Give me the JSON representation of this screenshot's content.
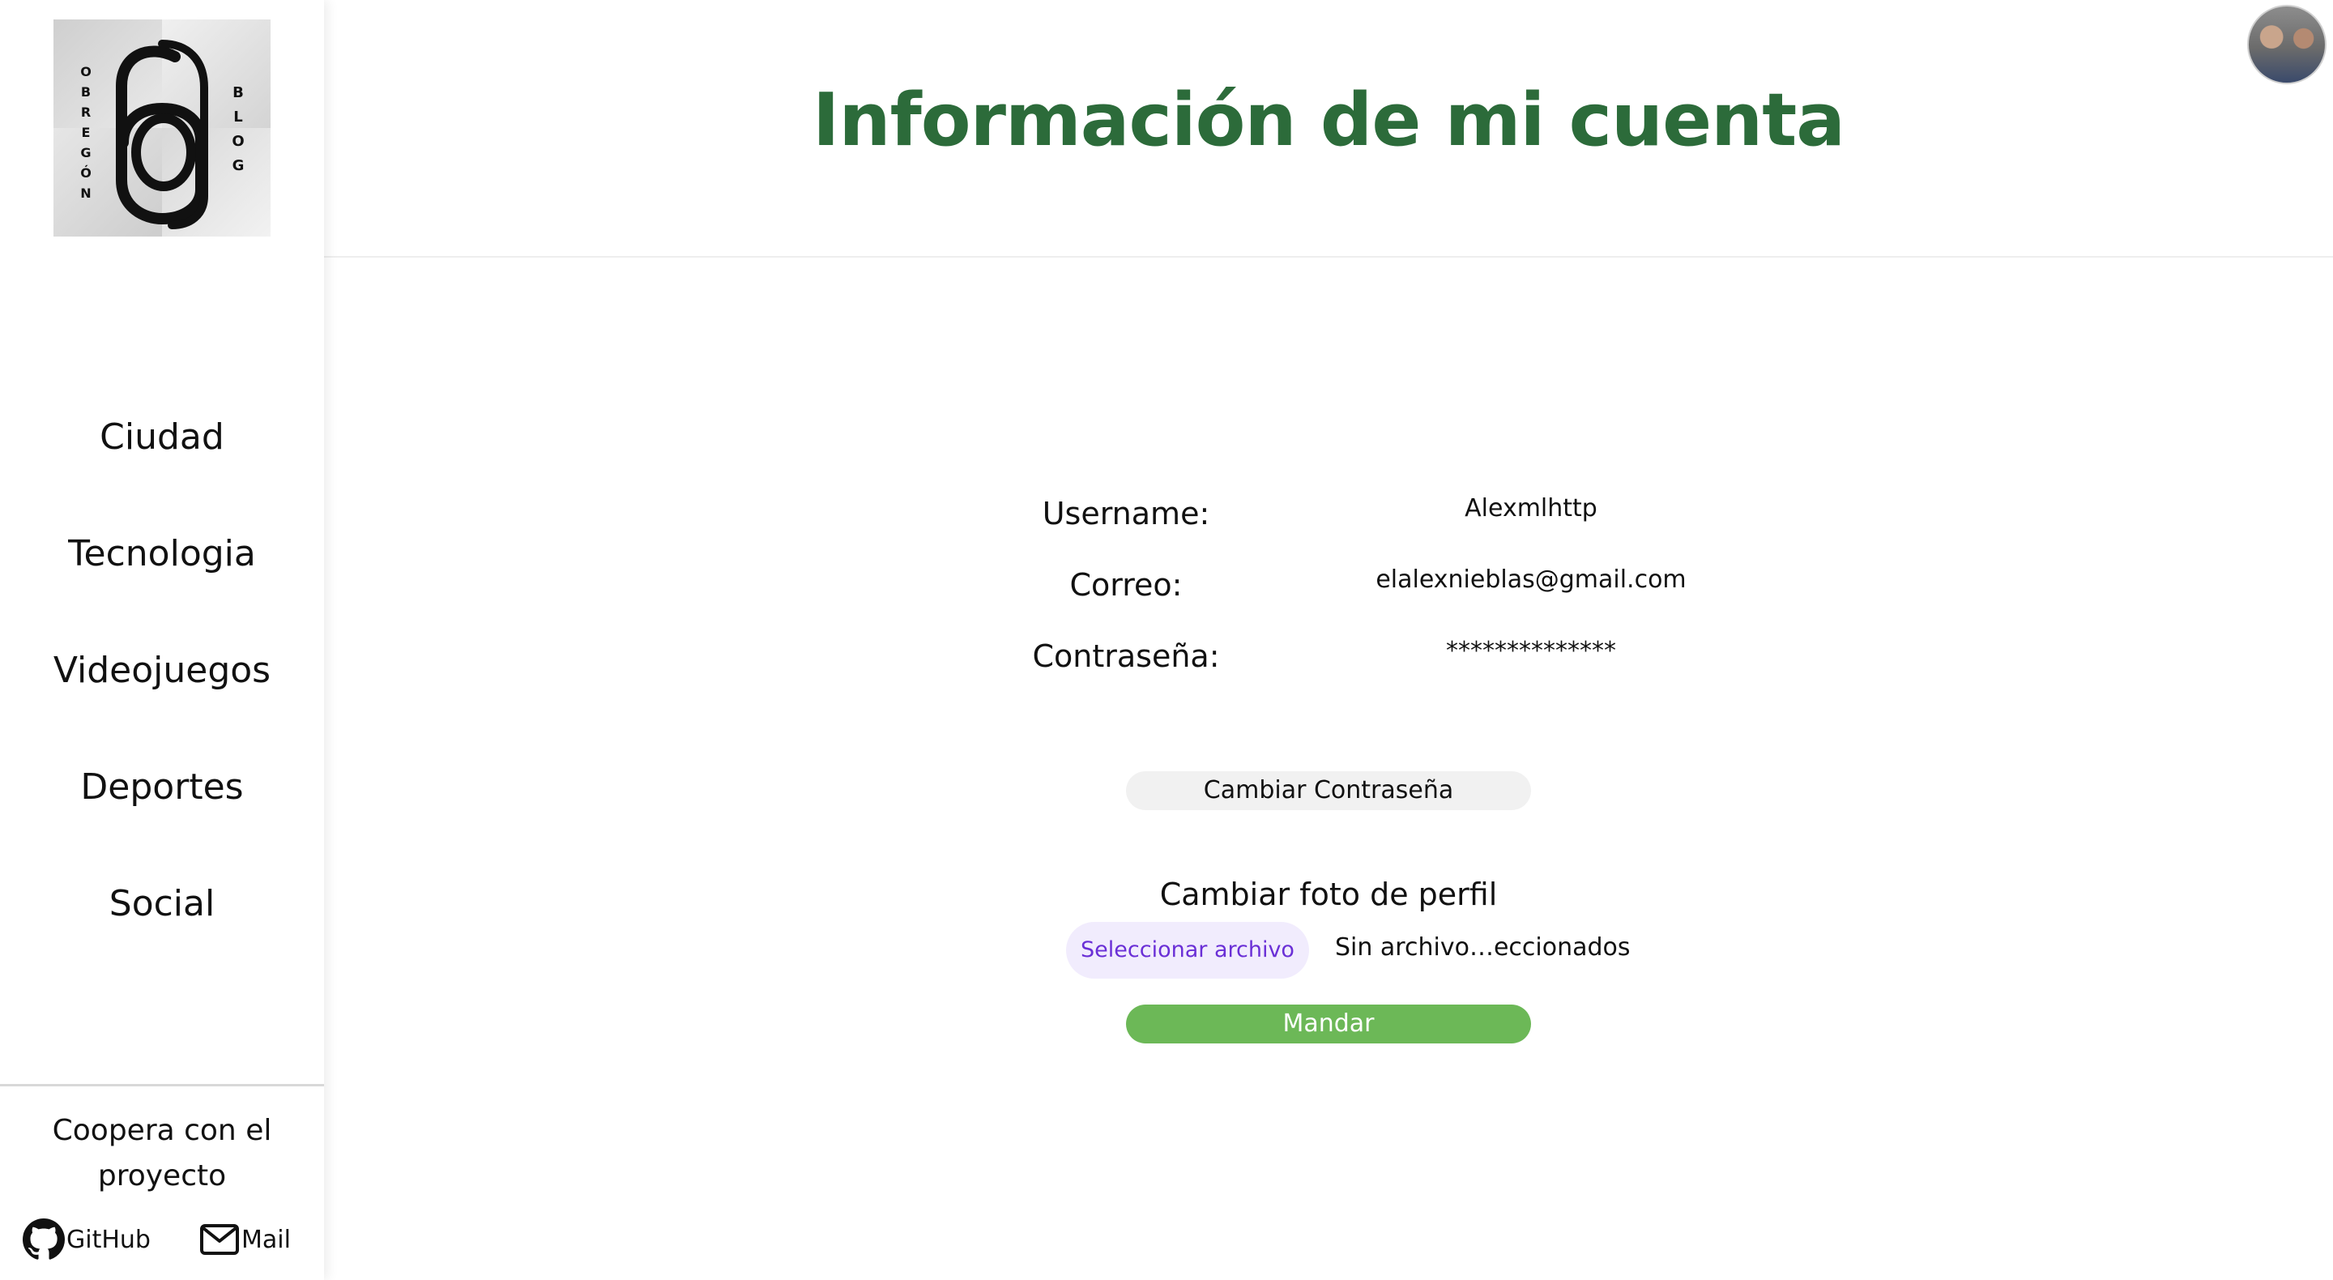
{
  "logo": {
    "left_text": "OBREGÓN",
    "right_text": "BLOG",
    "mark": "6g"
  },
  "sidebar": {
    "items": [
      {
        "label": "Ciudad"
      },
      {
        "label": "Tecnologia"
      },
      {
        "label": "Videojuegos"
      },
      {
        "label": "Deportes"
      },
      {
        "label": "Social"
      }
    ],
    "cooperate_line1": "Coopera con el",
    "cooperate_line2": "proyecto",
    "github_label": "GitHub",
    "mail_label": "Mail"
  },
  "header": {
    "title": "Información de mi cuenta"
  },
  "account": {
    "username_label": "Username:",
    "username_value": "Alexmlhttp",
    "email_label": "Correo:",
    "email_value": "elalexnieblas@gmail.com",
    "password_label": "Contraseña:",
    "password_value": "**************",
    "change_password_button": "Cambiar Contraseña",
    "profile_photo_title": "Cambiar foto de perfil",
    "select_file_button": "Seleccionar archivo",
    "file_status": "Sin archivo…eccionados",
    "submit_button": "Mandar"
  },
  "colors": {
    "title_green": "#2c6b3a",
    "submit_green": "#6cb857",
    "file_button_text": "#6a2fd6",
    "file_button_bg": "#f1ecfd"
  },
  "icons": {
    "github": "github-icon",
    "mail": "mail-icon",
    "avatar": "user-avatar"
  }
}
